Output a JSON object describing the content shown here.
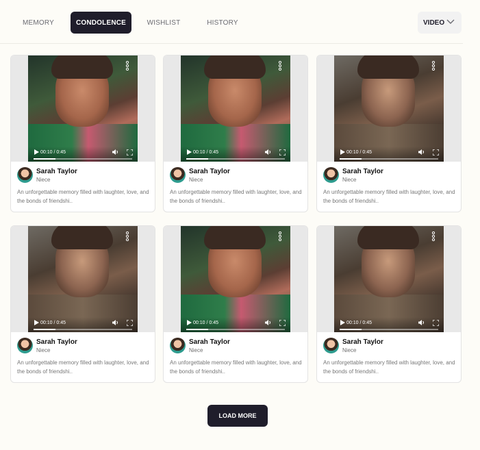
{
  "tabs": [
    {
      "label": "MEMORY",
      "active": false
    },
    {
      "label": "CONDOLENCE",
      "active": true
    },
    {
      "label": "WISHLIST",
      "active": false
    },
    {
      "label": "HISTORY",
      "active": false
    }
  ],
  "filter": {
    "label": "VIDEO",
    "icon": "chevron-down-icon"
  },
  "colors": {
    "accent": "#1f1d2b",
    "background": "#fdfcf7",
    "card_border": "#e3e3e3"
  },
  "cards": [
    {
      "video": {
        "style": "green",
        "time": "00:10 / 0:45",
        "progress": 0.22
      },
      "author": "Sarah Taylor",
      "relation": "Niece",
      "description": "An unforgettable memory filled with laughter, love, and the bonds of friendshi.."
    },
    {
      "video": {
        "style": "green",
        "time": "00:10 / 0:45",
        "progress": 0.22
      },
      "author": "Sarah Taylor",
      "relation": "Niece",
      "description": "An unforgettable memory filled with laughter, love, and the bonds of friendshi.."
    },
    {
      "video": {
        "style": "window",
        "time": "00:10 / 0:45",
        "progress": 0.22
      },
      "author": "Sarah Taylor",
      "relation": "Niece",
      "description": "An unforgettable memory filled with laughter, love, and the bonds of friendshi.."
    },
    {
      "video": {
        "style": "window",
        "time": "00:10 / 0:45",
        "progress": 0.22
      },
      "author": "Sarah Taylor",
      "relation": "Niece",
      "description": "An unforgettable memory filled with laughter, love, and the bonds of friendshi.."
    },
    {
      "video": {
        "style": "green",
        "time": "00:10 / 0:45",
        "progress": 0.22
      },
      "author": "Sarah Taylor",
      "relation": "Niece",
      "description": "An unforgettable memory filled with laughter, love, and the bonds of friendshi.."
    },
    {
      "video": {
        "style": "window",
        "time": "00:10 / 0:45",
        "progress": 0.22
      },
      "author": "Sarah Taylor",
      "relation": "Niece",
      "description": "An unforgettable memory filled with laughter, love, and the bonds of friendshi.."
    }
  ],
  "load_more": {
    "label": "LOAD MORE"
  }
}
